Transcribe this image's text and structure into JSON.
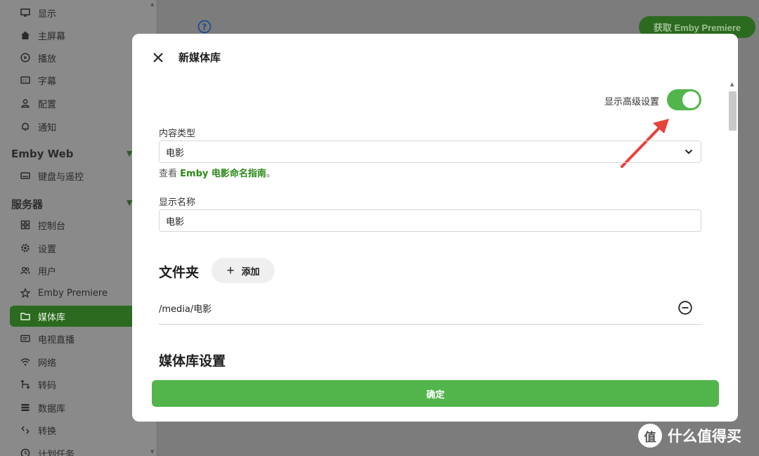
{
  "sidebar": {
    "items_top": [
      {
        "label": "显示",
        "icon": "monitor-icon"
      },
      {
        "label": "主屏幕",
        "icon": "home-icon"
      },
      {
        "label": "播放",
        "icon": "play-circle-icon"
      },
      {
        "label": "字幕",
        "icon": "subtitles-icon"
      },
      {
        "label": "配置",
        "icon": "person-icon"
      },
      {
        "label": "通知",
        "icon": "bell-icon"
      }
    ],
    "section_web": "Emby Web",
    "items_web": [
      {
        "label": "键盘与遥控",
        "icon": "keyboard-icon"
      }
    ],
    "section_server": "服务器",
    "items_server": [
      {
        "label": "控制台",
        "icon": "dashboard-icon"
      },
      {
        "label": "设置",
        "icon": "gear-icon"
      },
      {
        "label": "用户",
        "icon": "users-icon"
      },
      {
        "label": "Emby Premiere",
        "icon": "star-icon"
      },
      {
        "label": "媒体库",
        "icon": "folder-icon",
        "active": true
      },
      {
        "label": "电视直播",
        "icon": "tv-icon"
      },
      {
        "label": "网络",
        "icon": "wifi-icon"
      },
      {
        "label": "转码",
        "icon": "transcode-icon"
      },
      {
        "label": "数据库",
        "icon": "database-icon"
      },
      {
        "label": "转换",
        "icon": "convert-icon"
      },
      {
        "label": "计划任务",
        "icon": "clock-icon"
      }
    ]
  },
  "header": {
    "premiere_button": "获取 Emby Premiere"
  },
  "dialog": {
    "title": "新媒体库",
    "advanced_label": "显示高级设置",
    "advanced_on": true,
    "content_type_label": "内容类型",
    "content_type_value": "电影",
    "hint_prefix": "查看 ",
    "hint_link": "Emby 电影命名指南",
    "hint_suffix": "。",
    "display_name_label": "显示名称",
    "display_name_value": "电影",
    "folders_title": "文件夹",
    "add_button": "添加",
    "folders": [
      "/media/电影"
    ],
    "library_settings_title": "媒体库设置",
    "confirm_button": "确定"
  },
  "watermark": {
    "badge": "值",
    "text": "什么值得买"
  },
  "colors": {
    "accent_green": "#52b54b",
    "link_green": "#2a8a16",
    "annotation_red": "#e8403a"
  }
}
